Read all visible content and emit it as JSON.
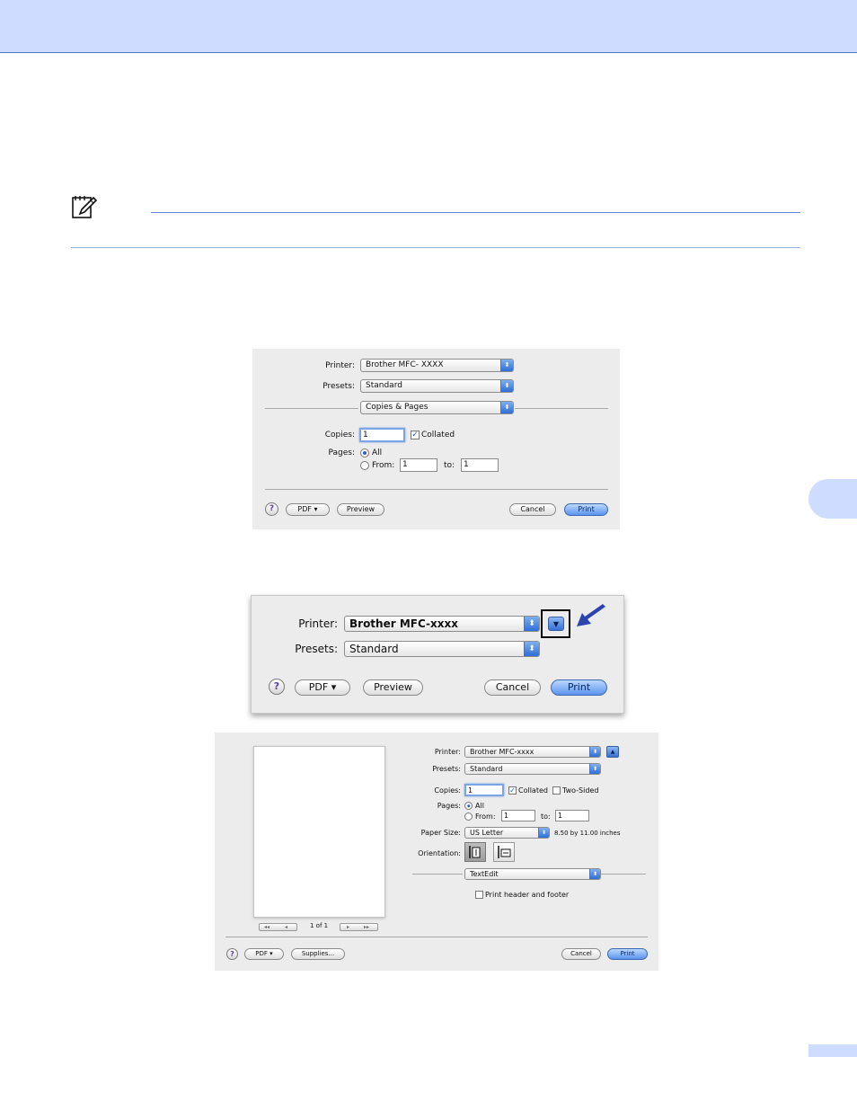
{
  "dialog1": {
    "printer_label": "Printer:",
    "printer_value": "Brother MFC- XXXX",
    "presets_label": "Presets:",
    "presets_value": "Standard",
    "panel_value": "Copies & Pages",
    "copies_label": "Copies:",
    "copies_value": "1",
    "collated_label": "Collated",
    "pages_label": "Pages:",
    "all_label": "All",
    "from_label": "From:",
    "from_value": "1",
    "to_label": "to:",
    "to_value": "1",
    "help_label": "?",
    "pdf_label": "PDF ▾",
    "preview_label": "Preview",
    "cancel_label": "Cancel",
    "print_label": "Print"
  },
  "dialog2": {
    "printer_label": "Printer:",
    "printer_value": "Brother MFC-xxxx",
    "presets_label": "Presets:",
    "presets_value": "Standard",
    "expand_label": "▼",
    "help_label": "?",
    "pdf_label": "PDF ▾",
    "preview_label": "Preview",
    "cancel_label": "Cancel",
    "print_label": "Print"
  },
  "dialog3": {
    "printer_label": "Printer:",
    "printer_value": "Brother MFC-xxxx",
    "collapse_label": "▲",
    "presets_label": "Presets:",
    "presets_value": "Standard",
    "copies_label": "Copies:",
    "copies_value": "1",
    "collated_label": "Collated",
    "two_sided_label": "Two-Sided",
    "pages_label": "Pages:",
    "all_label": "All",
    "from_label": "From:",
    "from_value": "1",
    "to_label": "to:",
    "to_value": "1",
    "paper_size_label": "Paper Size:",
    "paper_size_value": "US Letter",
    "paper_dims": "8.50 by 11.00 inches",
    "orientation_label": "Orientation:",
    "panel_value": "TextEdit",
    "header_footer_label": "Print header and footer",
    "page_counter": "1 of 1",
    "nav_first": "◂◂",
    "nav_prev": "◂",
    "nav_next": "▸",
    "nav_last": "▸▸",
    "help_label": "?",
    "pdf_label": "PDF ▾",
    "supplies_label": "Supplies...",
    "cancel_label": "Cancel",
    "print_label": "Print"
  },
  "colors": {
    "header_band": "#cddcff",
    "rule_blue": "#5d85d8",
    "arrow_blue": "#2c44b0"
  },
  "icons": [
    "note-pencil-icon",
    "blue-arrow-icon",
    "portrait-orientation-icon",
    "landscape-orientation-icon"
  ]
}
